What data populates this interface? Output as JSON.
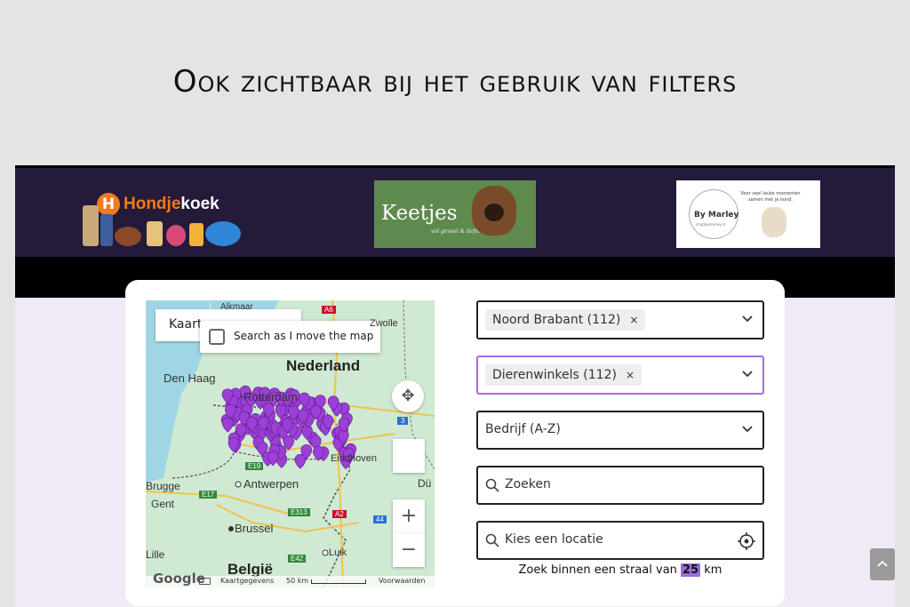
{
  "headline": "Ook zichtbaar bij het gebruik van filters",
  "banner": {
    "logo1": {
      "part_orange": "Hondje",
      "part_white": "koek",
      "badge": "H"
    },
    "logo2": {
      "name": "Keetjes",
      "sub": "vol gevoel & liefde"
    },
    "logo3": {
      "name": "By Marley",
      "sub": "shopbymarley.nl",
      "tagline": "Voor veel leuke momenten samen met je hond."
    }
  },
  "map": {
    "maptype_label": "Kaart",
    "search_as_move": "Search as I move the map",
    "labels": {
      "alkmaar": "Alkmaar",
      "zwolle": "Zwolle",
      "nederland": "Nederland",
      "den_haag": "Den Haag",
      "rotterdam": "Rotterdam",
      "eindhoven": "Eindhoven",
      "brugge": "Brugge",
      "antwerpen": "Antwerpen",
      "gent": "Gent",
      "brussel": "Brussel",
      "belgie": "België",
      "luik": "Luik",
      "lille": "Lille",
      "duisburg": "Dü",
      "road_a6": "A6",
      "road_3": "3",
      "road_e19": "E19",
      "road_e17": "E17",
      "road_e313": "E313",
      "road_a2": "A2",
      "road_44": "44",
      "road_e42": "E42"
    },
    "zoom_in": "+",
    "zoom_out": "−",
    "footer": {
      "google": "Google",
      "data": "Kaartgegevens",
      "scale": "50 km",
      "terms": "Voorwaarden"
    },
    "marker_color": "#9b3fd6",
    "marker_count": 112
  },
  "filters": {
    "province": {
      "chip": "Noord Brabant (112)",
      "remove": "×"
    },
    "category": {
      "chip": "Dierenwinkels (112)",
      "remove": "×"
    },
    "sort": {
      "value": "Bedrijf (A-Z)"
    },
    "search": {
      "placeholder": "Zoeken"
    },
    "location": {
      "placeholder": "Kies een locatie"
    }
  },
  "radius": {
    "prefix": "Zoek binnen een straal van",
    "value": "25",
    "unit": "km"
  },
  "colors": {
    "banner": "#241a3a",
    "accent": "#a76be0",
    "brand_orange": "#f27a1a"
  }
}
